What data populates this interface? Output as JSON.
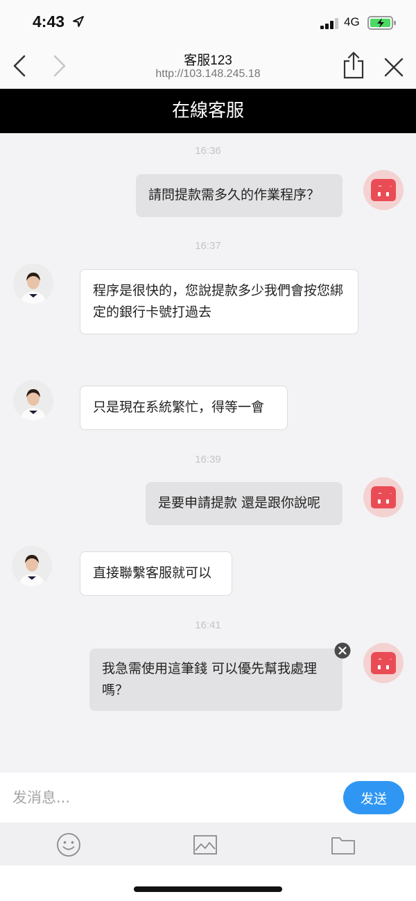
{
  "status_bar": {
    "time": "4:43",
    "network": "4G",
    "location_icon": "location-arrow-icon",
    "signal_icon": "signal-bars-icon",
    "battery_icon": "battery-charging-icon"
  },
  "browser": {
    "title": "客服123",
    "url": "http://103.148.245.18",
    "back_icon": "chevron-left-icon",
    "forward_icon": "chevron-right-icon",
    "share_icon": "share-icon",
    "close_icon": "close-icon"
  },
  "chat": {
    "title": "在線客服",
    "messages": [
      {
        "time": "16:36",
        "from": "user",
        "text": "請問提款需多久的作業程序？"
      },
      {
        "time": "16:37",
        "from": "agent",
        "text": "程序是很快的，您說提款多少我們會按您綁定的銀行卡號打過去"
      },
      {
        "from": "agent",
        "text": "只是現在系統繁忙，得等一會"
      },
      {
        "time": "16:39",
        "from": "user",
        "text": "是要申請提款 還是跟你說呢"
      },
      {
        "from": "agent",
        "text": "直接聯繫客服就可以"
      },
      {
        "time": "16:41",
        "from": "user",
        "text": "我急需使用這筆錢 可以優先幫我處理嗎？",
        "failed": true
      }
    ]
  },
  "input": {
    "placeholder": "发消息...",
    "value": "",
    "send_label": "发送"
  },
  "toolbar": {
    "icons": [
      "emoji-icon",
      "image-icon",
      "folder-icon"
    ]
  },
  "colors": {
    "title_bar": "#000000",
    "send_button": "#2f97f3",
    "user_avatar": "#ea4c56",
    "outgoing_bubble": "#e2e2e4",
    "incoming_bubble": "#ffffff"
  }
}
